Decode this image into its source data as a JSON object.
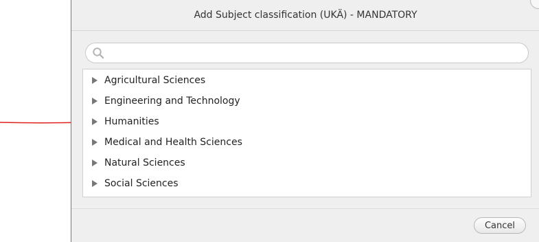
{
  "dialog": {
    "title": "Add Subject classification (UKÄ) - MANDATORY",
    "search": {
      "value": "",
      "placeholder": ""
    },
    "tree": {
      "items": [
        {
          "label": "Agricultural Sciences"
        },
        {
          "label": "Engineering and Technology"
        },
        {
          "label": "Humanities"
        },
        {
          "label": "Medical and Health Sciences"
        },
        {
          "label": "Natural Sciences"
        },
        {
          "label": "Social Sciences"
        }
      ]
    },
    "cancel_label": "Cancel"
  },
  "icons": {
    "search": "search-icon",
    "expand": "caret-right-icon",
    "annotation": "arrow-right-icon"
  },
  "colors": {
    "annotation_arrow": "#e0201c",
    "dialog_background": "#efefef"
  }
}
